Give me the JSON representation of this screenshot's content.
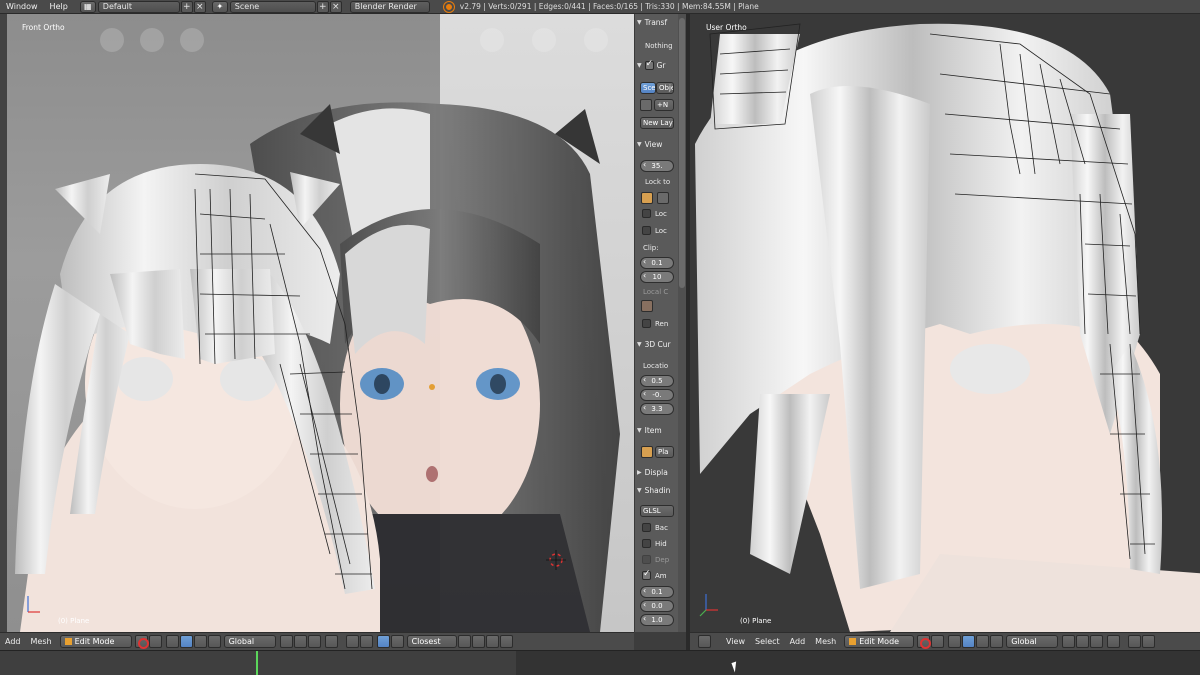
{
  "topbar": {
    "menu_window": "Window",
    "menu_help": "Help",
    "screen_layout": "Default",
    "scene": "Scene",
    "render_engine": "Blender Render",
    "stats": "v2.79 | Verts:0/291 | Edges:0/441 | Faces:0/165 | Tris:330 | Mem:84.55M | Plane"
  },
  "left_viewport": {
    "view_label": "Front Ortho",
    "object_label": "(0) Plane"
  },
  "right_viewport": {
    "view_label": "User Ortho",
    "object_label": "(0) Plane"
  },
  "npanel": {
    "transform_header": "Transf",
    "nothing_text": "Nothing",
    "grease_header": "Gr",
    "scene_btn": "Sce",
    "object_btn": "Obje",
    "new_layer_btn": "New Lay",
    "view_header": "View",
    "lens_value": "35.",
    "lock_to_label": "Lock to",
    "lock_cursor_label": "Loc",
    "lock_camera_label": "Loc",
    "clip_label": "Clip:",
    "clip_start": "0.1",
    "clip_end": "10",
    "local_camera_label": "Local C",
    "render_border_label": "Ren",
    "cursor_header": "3D Cur",
    "location_label": "Locatio",
    "loc_x": "0.5",
    "loc_y": "-0.",
    "loc_z": "3.3",
    "item_header": "Item",
    "item_name": "Pla",
    "display_header": "Displa",
    "shading_header": "Shadin",
    "shading_mode": "GLSL",
    "backface_label": "Bac",
    "hidden_wire_label": "Hid",
    "depth_label": "Dep",
    "ambient_label": "Am",
    "val_1": "0.1",
    "val_2": "0.0",
    "val_3": "1.0"
  },
  "left_header": {
    "menu_add": "Add",
    "menu_mesh": "Mesh",
    "mode": "Edit Mode",
    "orientation": "Global",
    "snap": "Closest"
  },
  "right_header": {
    "menu_view": "View",
    "menu_select": "Select",
    "menu_add": "Add",
    "menu_mesh": "Mesh",
    "mode": "Edit Mode",
    "orientation": "Global"
  }
}
